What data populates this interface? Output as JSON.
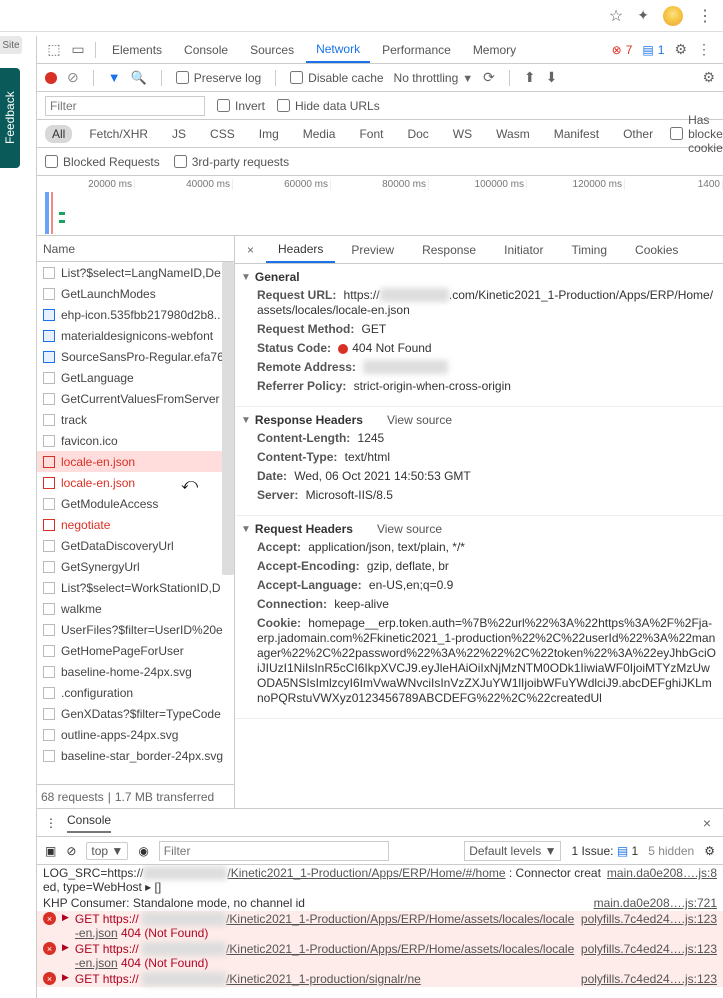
{
  "chrome": {
    "site_tab": "Site"
  },
  "side": {
    "feedback": "Feedback"
  },
  "tabs": {
    "items": [
      "Elements",
      "Console",
      "Sources",
      "Network",
      "Performance",
      "Memory"
    ],
    "active": "Network",
    "errors": "7",
    "messages": "1"
  },
  "toolbar": {
    "preserve": "Preserve log",
    "disable_cache": "Disable cache",
    "throttling": "No throttling"
  },
  "filterbar": {
    "placeholder": "Filter",
    "invert": "Invert",
    "hide_data": "Hide data URLs"
  },
  "types": {
    "all": "All",
    "items": [
      "Fetch/XHR",
      "JS",
      "CSS",
      "Img",
      "Media",
      "Font",
      "Doc",
      "WS",
      "Wasm",
      "Manifest",
      "Other"
    ],
    "has_blocked": "Has blocked cookies"
  },
  "blocked": {
    "blocked": "Blocked Requests",
    "thirdparty": "3rd-party requests"
  },
  "timeline": {
    "ticks": [
      "20000 ms",
      "40000 ms",
      "60000 ms",
      "80000 ms",
      "100000 ms",
      "120000 ms",
      "1400"
    ]
  },
  "list": {
    "header": "Name",
    "items": [
      {
        "t": "List?$select=LangNameID,De",
        "k": "norm"
      },
      {
        "t": "GetLaunchModes",
        "k": "norm"
      },
      {
        "t": "ehp-icon.535fbb217980d2b8..",
        "k": "blue"
      },
      {
        "t": "materialdesignicons-webfont",
        "k": "blue"
      },
      {
        "t": "SourceSansPro-Regular.efa76",
        "k": "blue"
      },
      {
        "t": "GetLanguage",
        "k": "norm"
      },
      {
        "t": "GetCurrentValuesFromServer",
        "k": "norm"
      },
      {
        "t": "track",
        "k": "norm"
      },
      {
        "t": "favicon.ico",
        "k": "norm"
      },
      {
        "t": "locale-en.json",
        "k": "err",
        "sel": true
      },
      {
        "t": "locale-en.json",
        "k": "err"
      },
      {
        "t": "GetModuleAccess",
        "k": "norm"
      },
      {
        "t": "negotiate",
        "k": "err"
      },
      {
        "t": "GetDataDiscoveryUrl",
        "k": "norm"
      },
      {
        "t": "GetSynergyUrl",
        "k": "norm"
      },
      {
        "t": "List?$select=WorkStationID,D",
        "k": "norm"
      },
      {
        "t": "walkme",
        "k": "norm"
      },
      {
        "t": "UserFiles?$filter=UserID%20e",
        "k": "norm"
      },
      {
        "t": "GetHomePageForUser",
        "k": "norm"
      },
      {
        "t": "baseline-home-24px.svg",
        "k": "norm"
      },
      {
        "t": ".configuration",
        "k": "norm"
      },
      {
        "t": "GenXDatas?$filter=TypeCode",
        "k": "norm"
      },
      {
        "t": "outline-apps-24px.svg",
        "k": "norm"
      },
      {
        "t": "baseline-star_border-24px.svg",
        "k": "norm"
      }
    ],
    "status_a": "68 requests",
    "status_b": "1.7 MB transferred"
  },
  "detail": {
    "tabs": [
      "Headers",
      "Preview",
      "Response",
      "Initiator",
      "Timing",
      "Cookies"
    ],
    "general": {
      "title": "General",
      "url_label": "Request URL:",
      "url_a": "https://",
      "url_b": ".com/Kinetic2021_1-Production/Apps/ERP/Home/assets/locales/locale-en.json",
      "method_label": "Request Method:",
      "method": "GET",
      "status_label": "Status Code:",
      "status": "404 Not Found",
      "remote_label": "Remote Address:",
      "referrer_label": "Referrer Policy:",
      "referrer": "strict-origin-when-cross-origin"
    },
    "resp": {
      "title": "Response Headers",
      "vs": "View source",
      "cl_k": "Content-Length:",
      "cl_v": "1245",
      "ct_k": "Content-Type:",
      "ct_v": "text/html",
      "dt_k": "Date:",
      "dt_v": "Wed, 06 Oct 2021 14:50:53 GMT",
      "sv_k": "Server:",
      "sv_v": "Microsoft-IIS/8.5"
    },
    "req": {
      "title": "Request Headers",
      "vs": "View source",
      "ac_k": "Accept:",
      "ac_v": "application/json, text/plain, */*",
      "ae_k": "Accept-Encoding:",
      "ae_v": "gzip, deflate, br",
      "al_k": "Accept-Language:",
      "al_v": "en-US,en;q=0.9",
      "cn_k": "Connection:",
      "cn_v": "keep-alive",
      "ck_k": "Cookie:",
      "ck_v": "homepage__erp.token.auth=%7B%22url%22%3A%22https%3A%2F%2Fja-erp.jadomain.com%2Fkinetic2021_1-production%22%2C%22userId%22%3A%22manager%22%2C%22password%22%3A%22%22%2C%22token%22%3A%22eyJhbGciOiJIUzI1NiIsInR5cCI6IkpXVCJ9.eyJleHAiOiIxNjMzNTM0ODk1IiwiaWF0IjoiMTYzMzUwODA5NSIsImlzcyI6ImVwaWNvciIsInVzZXJuYW1lIjoibWFuYWdlciJ9.abcDEFghiJKLmnoPQRstuVWXyz0123456789ABCDEFG%22%2C%22createdUl"
    }
  },
  "console": {
    "tab": "Console",
    "top": "top",
    "filter": "Filter",
    "levels": "Default levels",
    "issue": "1 Issue:",
    "issue_n": "1",
    "hidden": "5 hidden",
    "lines": [
      {
        "type": "log",
        "msg_a": "LOG_SRC=https://",
        "msg_b": "/Kinetic2021_1-Production/Apps/ERP/Home/#/home",
        "msg_c": ": Connector created, type=WebHost ▸ []",
        "src": "main.da0e208….js:8"
      },
      {
        "type": "log",
        "msg": "KHP Consumer: Standalone mode, no channel id",
        "src": "main.da0e208….js:721"
      },
      {
        "type": "err",
        "msg_a": "GET https://",
        "msg_b": "/Kinetic2021_1-Production/Apps/ERP/Home/assets/locales/locale-en.json",
        "code": "404 (Not Found)",
        "src": "polyfills.7c4ed24….js:123"
      },
      {
        "type": "err",
        "msg_a": "GET https://",
        "msg_b": "/Kinetic2021_1-Production/Apps/ERP/Home/assets/locales/locale-en.json",
        "code": "404 (Not Found)",
        "src": "polyfills.7c4ed24….js:123"
      },
      {
        "type": "err",
        "msg_a": "GET https://",
        "msg_b": "/Kinetic2021_1-production/signalr/ne",
        "code": "",
        "src": "polyfills.7c4ed24….js:123"
      }
    ]
  }
}
